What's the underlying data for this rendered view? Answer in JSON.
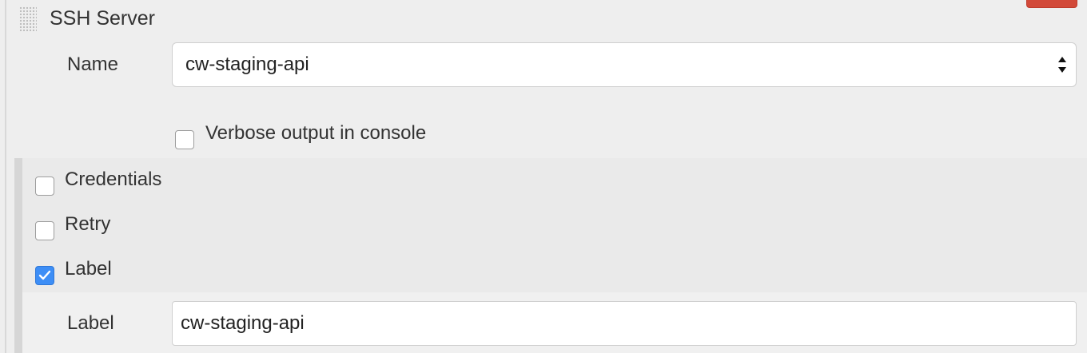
{
  "section": {
    "title": "SSH Server"
  },
  "name_field": {
    "label": "Name",
    "selected": "cw-staging-api"
  },
  "verbose": {
    "label": "Verbose output in console",
    "checked": false
  },
  "options": [
    {
      "label": "Credentials",
      "checked": false
    },
    {
      "label": "Retry",
      "checked": false
    },
    {
      "label": "Label",
      "checked": true
    }
  ],
  "label_field": {
    "label": "Label",
    "value": "cw-staging-api"
  },
  "colors": {
    "checked": "#3d8ef6",
    "danger": "#d24939"
  },
  "icons": {
    "drag": "drag-handle-icon",
    "select": "select-arrows-icon",
    "check": "checkmark-icon"
  }
}
